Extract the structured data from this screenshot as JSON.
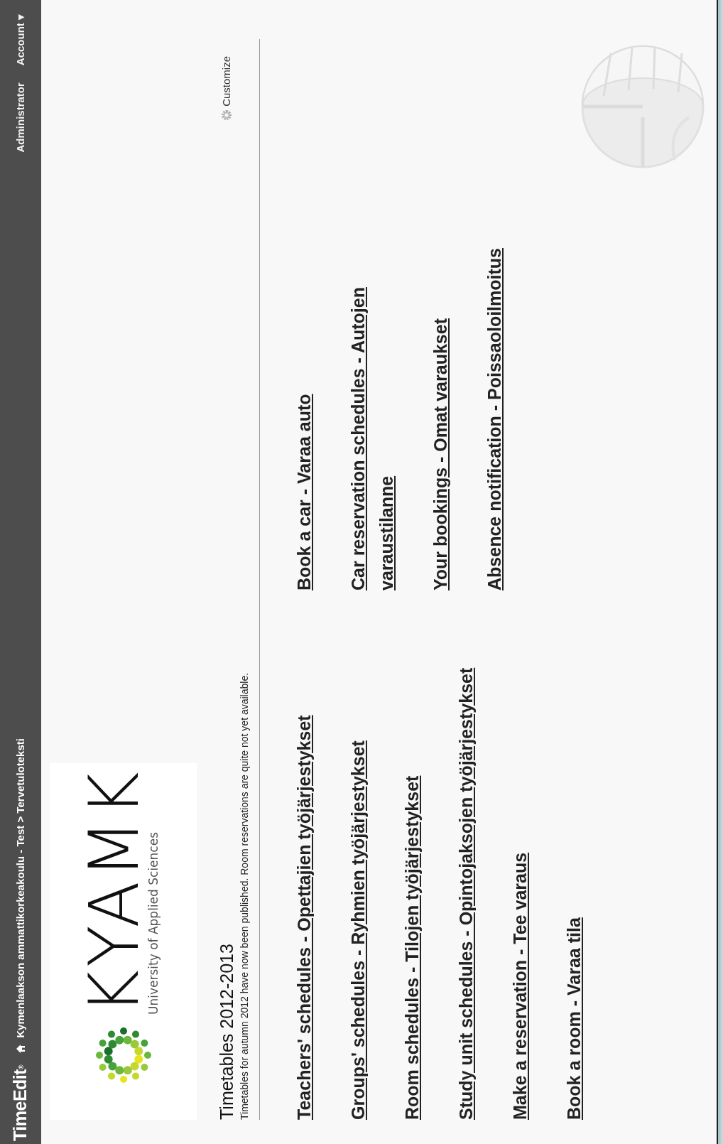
{
  "header": {
    "logo": "TimeEdit$^{®}$",
    "breadcrumb": "Kymenlaakson ammattikorkeakoulu - Test > Tervetuloteksti",
    "user": "Administrator",
    "account_menu": "Account ▾"
  },
  "logo": {
    "name": "KYAMK",
    "tagline": "University of Applied Sciences"
  },
  "customize": "Customize",
  "intro": {
    "title": "Timetables 2012-2013",
    "text": "Timetables for autumn 2012 have now been published. Room reservations are quite not yet available."
  },
  "links": {
    "column_1": [
      "Teachers' schedules - Opettajien työjärjestykset",
      "Groups' schedules - Ryhmien työjärjestykset",
      "Room schedules - Tilojen työjärjestykset",
      "Study unit schedules - Opintojaksojen työjärjestykset",
      "Make a reservation - Tee varaus",
      "Book a room - Varaa tila"
    ],
    "column_2": [
      "Book a car - Varaa auto",
      "Car reservation schedules - Autojen varaustilanne",
      "Your bookings - Omat varaukset",
      "Absence notification - Poissaoloilmoitus"
    ]
  }
}
